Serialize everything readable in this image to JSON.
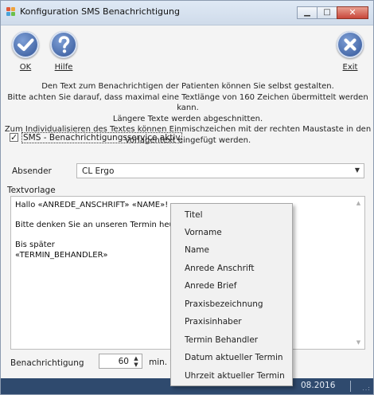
{
  "window": {
    "title": "Konfiguration SMS Benachrichtigung",
    "controls": {
      "minimize": "▁",
      "maximize": "□",
      "close": "✕"
    }
  },
  "toolbar": {
    "ok": {
      "label": "OK",
      "icon": "check-icon"
    },
    "help": {
      "label": "Hilfe",
      "icon": "help-icon"
    },
    "exit": {
      "label": "Exit",
      "icon": "close-icon"
    }
  },
  "intro": [
    "Den Text zum Benachrichtigen der Patienten können Sie selbst gestalten.",
    "Bitte achten Sie darauf, dass maximal eine Textlänge von 160 Zeichen übermittelt werden kann.",
    "Längere Texte werden abgeschnitten.",
    "Zum Individualisieren des Textes können Einmischzeichen mit der rechten Maustaste in den",
    "Vorlagentext eingefügt werden."
  ],
  "sms_checkbox": {
    "label": "SMS - Benachrichtigungsservice aktiv",
    "checked": true,
    "mark": "✓"
  },
  "absender": {
    "label": "Absender",
    "value": "CL Ergo",
    "arrow": "▼"
  },
  "textvorlage": {
    "label": "Textvorlage",
    "content": "Hallo «ANREDE_ANSCHRIFT» «NAME»!\n\nBitte denken Sie an unseren Termin heut\n\nBis später\n«TERMIN_BEHANDLER»",
    "scroll_up": "▲",
    "scroll_down": "▼"
  },
  "benachrichtigung": {
    "label": "Benachrichtigung",
    "value": "60",
    "unit": "min. v",
    "spin": "▲\n▼"
  },
  "statusbar": {
    "date": "08.2016",
    "grip": "..:"
  },
  "context_menu": {
    "items": [
      "Titel",
      "Vorname",
      "Name",
      "Anrede Anschrift",
      "Anrede Brief",
      "Praxisbezeichnung",
      "Praxisinhaber",
      "Termin Behandler",
      "Datum aktueller Termin",
      "Uhrzeit aktueller Termin"
    ]
  },
  "colors": {
    "titlebar": "#cfdbea",
    "toolbar_icon": "#2c4f92",
    "statusbar": "#2f4a6e",
    "close_button": "#c8473a"
  }
}
